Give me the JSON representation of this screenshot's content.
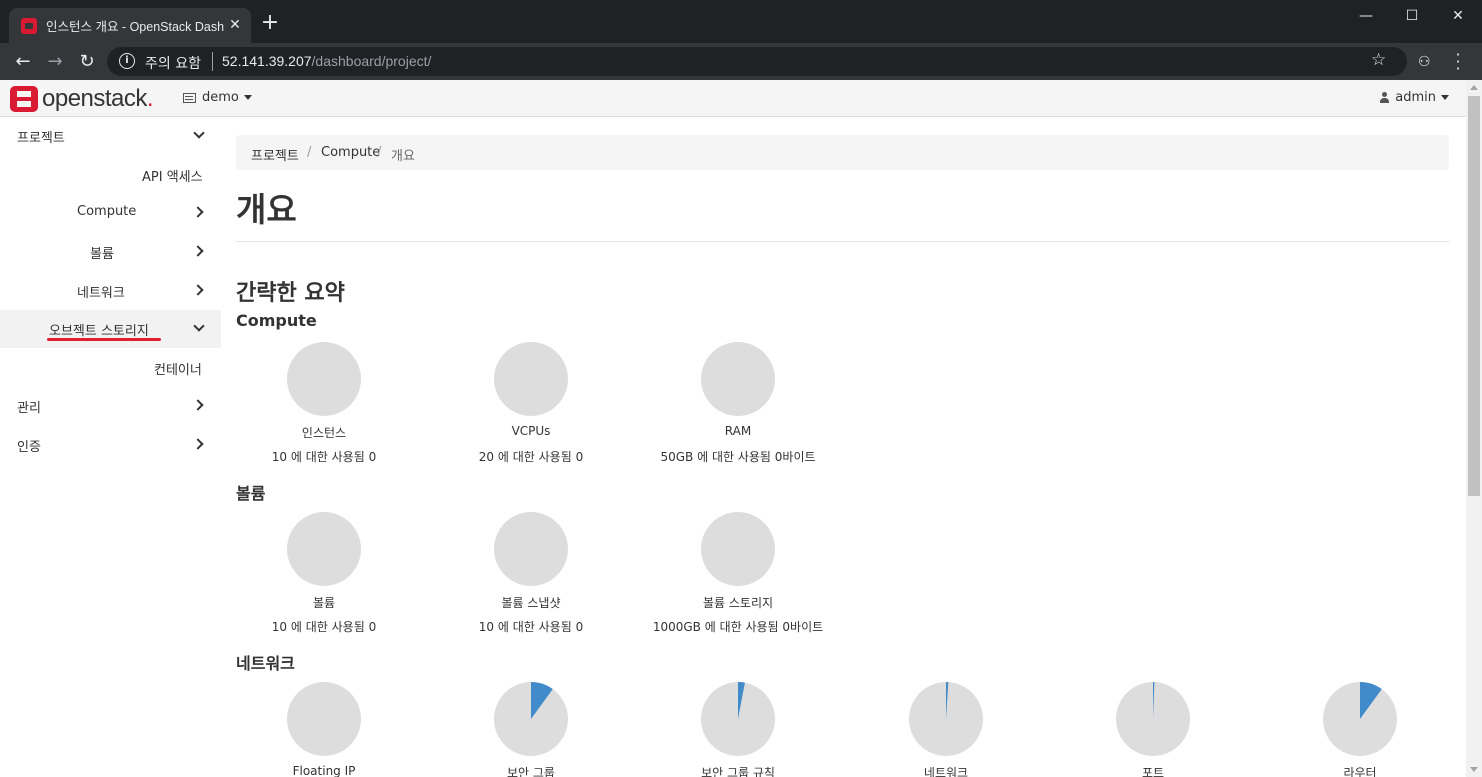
{
  "browser": {
    "tab_title": "인스턴스 개요 - OpenStack Dash",
    "address_warning": "주의 요함",
    "url_host": "52.141.39.207",
    "url_path": "/dashboard/project/"
  },
  "header": {
    "brand": "openstack",
    "brand_dot": ".",
    "project": "demo",
    "user": "admin"
  },
  "sidebar": {
    "items": [
      {
        "label": "프로젝트"
      },
      {
        "label": "API 액세스"
      },
      {
        "label": "Compute"
      },
      {
        "label": "볼륨"
      },
      {
        "label": "네트워크"
      },
      {
        "label": "오브젝트 스토리지"
      },
      {
        "label": "컨테이너"
      },
      {
        "label": "관리"
      },
      {
        "label": "인증"
      }
    ]
  },
  "breadcrumb": [
    "프로젝트",
    "Compute",
    "개요"
  ],
  "breadcrumb_sep": "/",
  "page_title": "개요",
  "summary_title": "간략한 요약",
  "sections": [
    {
      "title": "Compute",
      "charts": [
        {
          "label": "인스턴스",
          "sub": "10 에 대한 사용됨 0",
          "used_fraction": 0
        },
        {
          "label": "VCPUs",
          "sub": "20 에 대한 사용됨 0",
          "used_fraction": 0
        },
        {
          "label": "RAM",
          "sub": "50GB 에 대한 사용됨 0바이트",
          "used_fraction": 0
        }
      ]
    },
    {
      "title": "볼륨",
      "charts": [
        {
          "label": "볼륨",
          "sub": "10 에 대한 사용됨 0",
          "used_fraction": 0
        },
        {
          "label": "볼륨 스냅샷",
          "sub": "10 에 대한 사용됨 0",
          "used_fraction": 0
        },
        {
          "label": "볼륨 스토리지",
          "sub": "1000GB 에 대한 사용됨 0바이트",
          "used_fraction": 0
        }
      ]
    },
    {
      "title": "네트워크",
      "charts": [
        {
          "label": "Floating IP",
          "sub": "",
          "used_fraction": 0
        },
        {
          "label": "보안 그룹",
          "sub": "",
          "used_fraction": 0.1
        },
        {
          "label": "보안 그룹 규칙",
          "sub": "",
          "used_fraction": 0.03
        },
        {
          "label": "네트워크",
          "sub": "",
          "used_fraction": 0.01
        },
        {
          "label": "포트",
          "sub": "",
          "used_fraction": 0.006
        },
        {
          "label": "라우터",
          "sub": "",
          "used_fraction": 0.1
        }
      ]
    }
  ],
  "colors": {
    "pie_empty": "#dddddd",
    "pie_used": "#428bca",
    "accent": "#da1a32"
  }
}
